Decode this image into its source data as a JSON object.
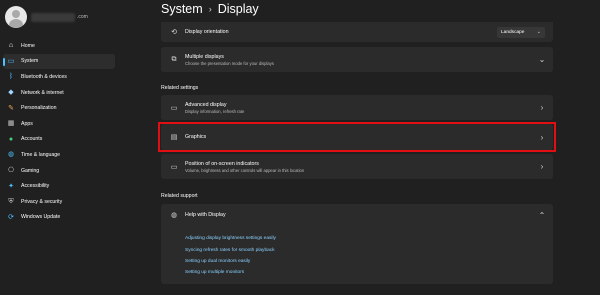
{
  "account": {
    "email_suffix": ".com"
  },
  "sidebar": {
    "items": [
      {
        "label": "Home",
        "icon": "home-icon",
        "glyph": "⌂",
        "color": "#ffffff",
        "active": false
      },
      {
        "label": "System",
        "icon": "system-icon",
        "glyph": "▭",
        "color": "#4cc2ff",
        "active": true
      },
      {
        "label": "Bluetooth & devices",
        "icon": "bluetooth-icon",
        "glyph": "ᛒ",
        "color": "#4cc2ff",
        "active": false
      },
      {
        "label": "Network & internet",
        "icon": "network-icon",
        "glyph": "◆",
        "color": "#9fd7ff",
        "active": false
      },
      {
        "label": "Personalization",
        "icon": "brush-icon",
        "glyph": "✎",
        "color": "#f0a55a",
        "active": false
      },
      {
        "label": "Apps",
        "icon": "apps-icon",
        "glyph": "▦",
        "color": "#c8c8c8",
        "active": false
      },
      {
        "label": "Accounts",
        "icon": "accounts-icon",
        "glyph": "●",
        "color": "#44d17a",
        "active": false
      },
      {
        "label": "Time & language",
        "icon": "globe-icon",
        "glyph": "◍",
        "color": "#4cc2ff",
        "active": false
      },
      {
        "label": "Gaming",
        "icon": "gaming-icon",
        "glyph": "⎔",
        "color": "#c8c8c8",
        "active": false
      },
      {
        "label": "Accessibility",
        "icon": "accessibility-icon",
        "glyph": "✦",
        "color": "#4cc2ff",
        "active": false
      },
      {
        "label": "Privacy & security",
        "icon": "shield-icon",
        "glyph": "⛨",
        "color": "#c8c8c8",
        "active": false
      },
      {
        "label": "Windows Update",
        "icon": "update-icon",
        "glyph": "⟳",
        "color": "#4cc2ff",
        "active": false
      }
    ]
  },
  "header": {
    "crumb_parent": "System",
    "crumb_current": "Display",
    "separator": "›"
  },
  "cards": {
    "orientation": {
      "title": "Display orientation",
      "value": "Landscape"
    },
    "multiple": {
      "title": "Multiple displays",
      "subtitle": "Choose the presentation mode for your displays"
    },
    "related_settings_label": "Related settings",
    "advanced": {
      "title": "Advanced display",
      "subtitle": "Display information, refresh rate"
    },
    "graphics": {
      "title": "Graphics"
    },
    "osd": {
      "title": "Position of on-screen indicators",
      "subtitle": "Volume, brightness and other controls will appear in this location"
    },
    "related_support_label": "Related support",
    "help": {
      "title": "Help with Display"
    }
  },
  "help_links": [
    "Adjusting display brightness settings easily",
    "Syncing refresh rates for smooth playback",
    "Setting up dual monitors easily",
    "Setting up multiple monitors"
  ],
  "colors": {
    "accent": "#4cc2ff",
    "highlight": "#e10e14",
    "link": "#8ad1ff"
  }
}
